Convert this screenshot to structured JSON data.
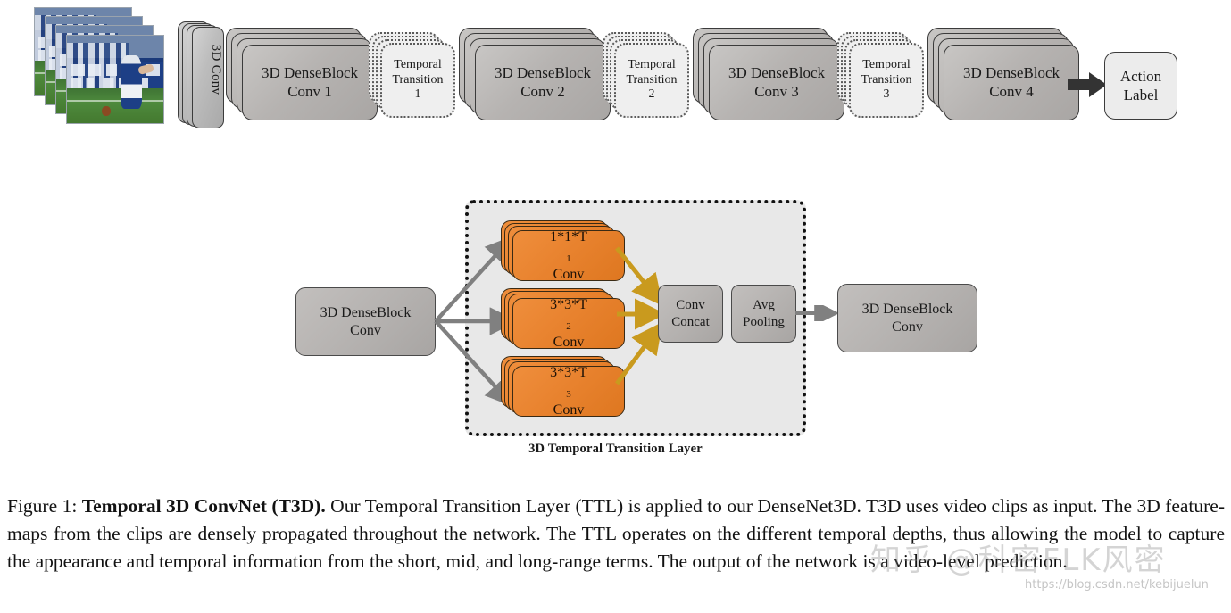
{
  "figure": {
    "number": "Figure 1:",
    "title": "Temporal 3D ConvNet (T3D).",
    "body": " Our Temporal Transition Layer (TTL) is applied to our DenseNet3D. T3D uses video clips as input. The 3D feature-maps from the clips are densely propagated throughout the network. The TTL operates on the different temporal depths, thus allowing the model to capture the appearance and temporal information from the short, mid, and long-range terms. The output of the network is a video-level prediction."
  },
  "pipeline": {
    "input_clips": {
      "name": "video-clip-stack",
      "frames": 4
    },
    "blocks": [
      {
        "id": "conv3d",
        "label": "3D Conv",
        "style": "slab-vertical"
      },
      {
        "id": "denseblock1",
        "line1": "3D DenseBlock",
        "line2": "Conv 1",
        "style": "gray-stack"
      },
      {
        "id": "transition1",
        "line1": "Temporal",
        "line2": "Transition",
        "line3": "1",
        "style": "dotted-stack"
      },
      {
        "id": "denseblock2",
        "line1": "3D DenseBlock",
        "line2": "Conv 2",
        "style": "gray-stack"
      },
      {
        "id": "transition2",
        "line1": "Temporal",
        "line2": "Transition",
        "line3": "2",
        "style": "dotted-stack"
      },
      {
        "id": "denseblock3",
        "line1": "3D DenseBlock",
        "line2": "Conv 3",
        "style": "gray-stack"
      },
      {
        "id": "transition3",
        "line1": "Temporal",
        "line2": "Transition",
        "line3": "3",
        "style": "dotted-stack"
      },
      {
        "id": "denseblock4",
        "line1": "3D DenseBlock",
        "line2": "Conv 4",
        "style": "gray-stack"
      }
    ],
    "output": {
      "id": "action-label",
      "line1": "Action",
      "line2": "Label",
      "style": "plain-box"
    }
  },
  "ttl": {
    "panel_caption": "3D Temporal Transition Layer",
    "input_block": {
      "line1": "3D DenseBlock",
      "line2": "Conv"
    },
    "branches": [
      {
        "id": "branch-1",
        "kernel": "1*1*T",
        "sub": "1",
        "line2": "Conv"
      },
      {
        "id": "branch-2",
        "kernel": "3*3*T",
        "sub": "2",
        "line2": "Conv"
      },
      {
        "id": "branch-3",
        "kernel": "3*3*T",
        "sub": "3",
        "line2": "Conv"
      }
    ],
    "concat": {
      "line1": "Conv",
      "line2": "Concat"
    },
    "pooling": {
      "line1": "Avg",
      "line2": "Pooling"
    },
    "output_block": {
      "line1": "3D DenseBlock",
      "line2": "Conv"
    }
  },
  "watermarks": {
    "zhihu": "知乎 @科密FLK风密",
    "url": "https://blog.csdn.net/kebijuelun"
  },
  "colors": {
    "orange": "#E8822E",
    "gray_block": "#B5B2B0",
    "gray_arrow": "#808080",
    "gold_arrow": "#C99A1E",
    "panel_bg": "#E8E8E8",
    "light_box": "#EFEFEF",
    "black_arrow": "#333333"
  }
}
